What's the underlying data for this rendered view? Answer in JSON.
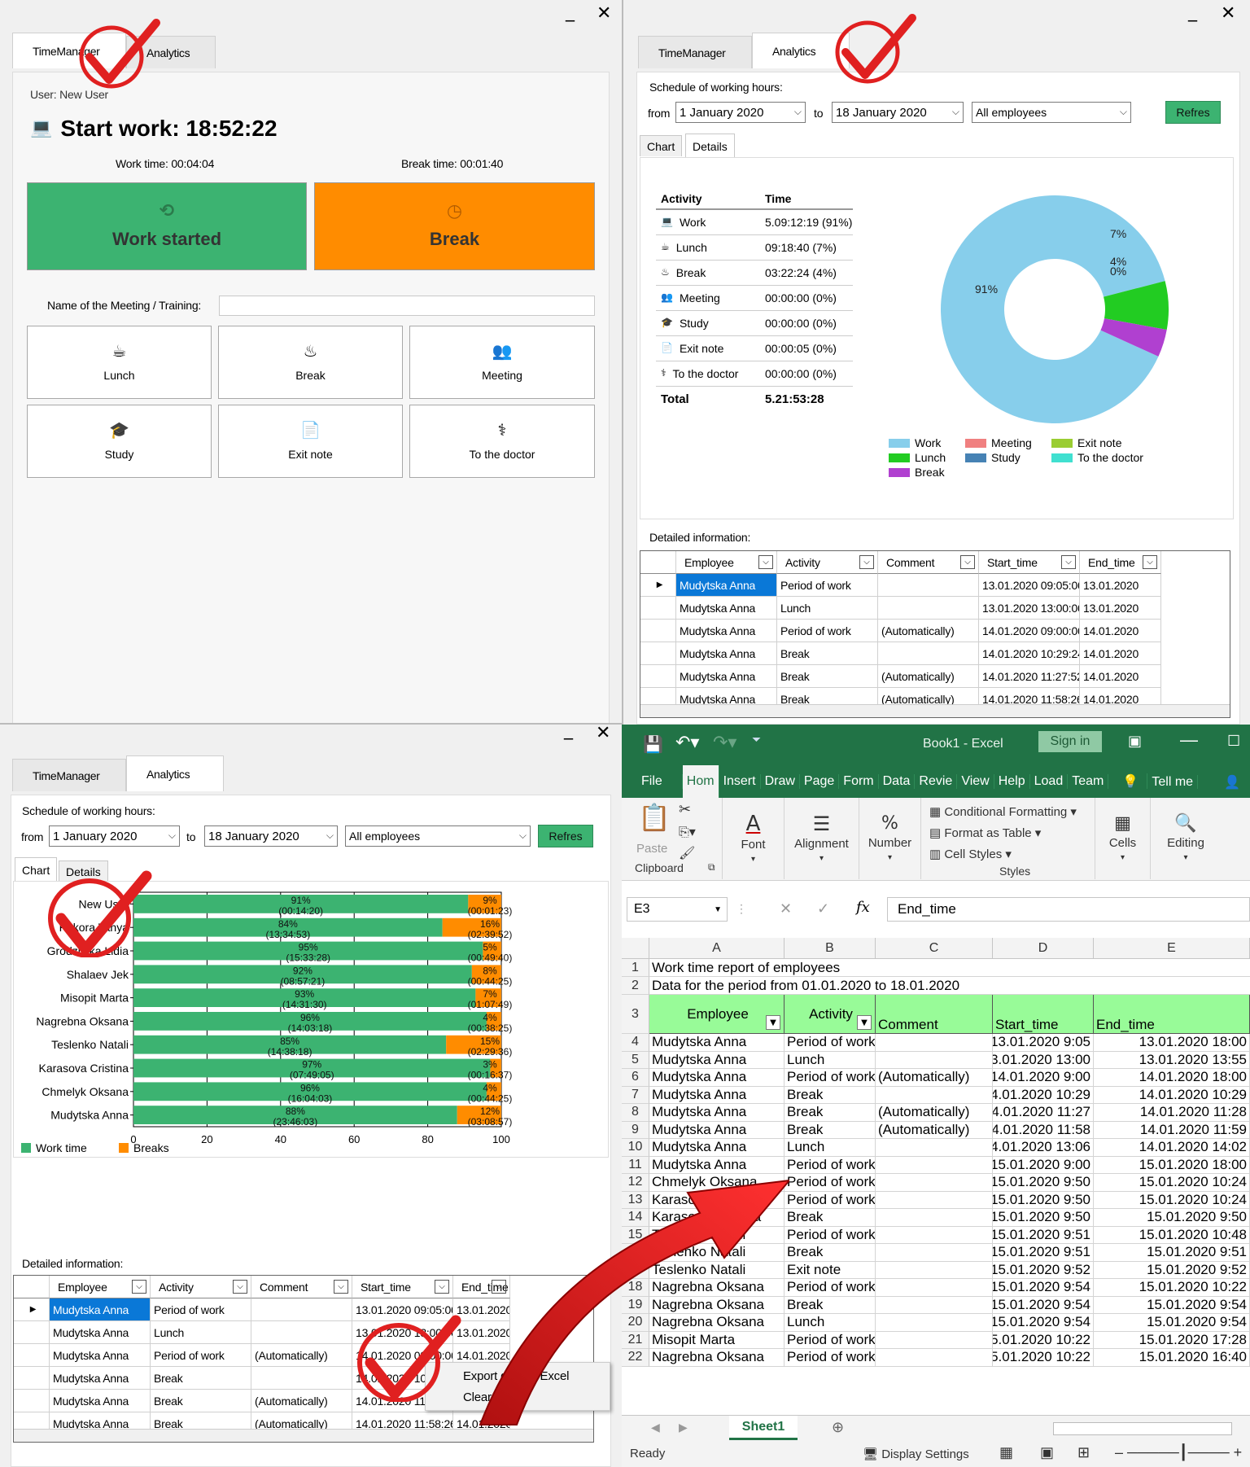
{
  "tm": {
    "tabs": [
      "TimeManager",
      "Analytics"
    ],
    "user": "User: New User",
    "start_work": "Start work: 18:52:22",
    "work_time": "Work time:  00:04:04",
    "break_time": "Break time:  00:01:40",
    "work_btn": "Work started",
    "break_btn": "Break",
    "meeting_label": "Name of the Meeting / Training:",
    "meeting_value": "",
    "actions": [
      "Lunch",
      "Break",
      "Meeting",
      "Study",
      "Exit note",
      "To the doctor"
    ]
  },
  "an": {
    "tabs": [
      "TimeManager",
      "Analytics"
    ],
    "schedule": "Schedule of working hours:",
    "from": "from",
    "from_val": "1 January 2020",
    "to": "to",
    "to_val": "18 January 2020",
    "emp": "All employees",
    "refresh": "Refres",
    "subtabs": [
      "Chart",
      "Details"
    ],
    "table_hdr": [
      "Activity",
      "Time"
    ],
    "rows": [
      {
        "icon": "laptop-icon",
        "glyph": "💻",
        "a": "Work",
        "t": "5.09:12:19 (91%)"
      },
      {
        "icon": "coffee-icon",
        "glyph": "☕",
        "a": "Lunch",
        "t": "09:18:40 (7%)"
      },
      {
        "icon": "relax-icon",
        "glyph": "♨",
        "a": "Break",
        "t": "03:22:24 (4%)"
      },
      {
        "icon": "people-icon",
        "glyph": "👥",
        "a": "Meeting",
        "t": "00:00:00 (0%)"
      },
      {
        "icon": "graduation-cap-icon",
        "glyph": "🎓",
        "a": "Study",
        "t": "00:00:00 (0%)"
      },
      {
        "icon": "document-icon",
        "glyph": "📄",
        "a": "Exit note",
        "t": "00:00:05 (0%)"
      },
      {
        "icon": "stethoscope-icon",
        "glyph": "⚕",
        "a": "To the doctor",
        "t": "00:00:00 (0%)"
      }
    ],
    "total_label": "Total",
    "total_val": "5.21:53:28",
    "detailed": "Detailed information:",
    "grid_hdr": [
      "Employee",
      "Activity",
      "Comment",
      "Start_time",
      "End_time"
    ],
    "grid_rows": [
      [
        "Mudytska Anna",
        "Period of work",
        "",
        "13.01.2020 09:05:00",
        "13.01.2020"
      ],
      [
        "Mudytska Anna",
        "Lunch",
        "",
        "13.01.2020 13:00:00",
        "13.01.2020"
      ],
      [
        "Mudytska Anna",
        "Period of work",
        "(Automatically)",
        "14.01.2020 09:00:00",
        "14.01.2020"
      ],
      [
        "Mudytska Anna",
        "Break",
        "",
        "14.01.2020 10:29:24",
        "14.01.2020"
      ],
      [
        "Mudytska Anna",
        "Break",
        "(Automatically)",
        "14.01.2020 11:27:52",
        "14.01.2020"
      ],
      [
        "Mudytska Anna",
        "Break",
        "(Automatically)",
        "14.01.2020 11:58:26",
        "14.01.2020"
      ]
    ]
  },
  "donut": {
    "type": "pie",
    "labels": [
      "Work",
      "Lunch",
      "Break",
      "Meeting",
      "Study",
      "Exit note",
      "To the doctor"
    ],
    "values": [
      91,
      7,
      4,
      0,
      0,
      0,
      0
    ],
    "slice_labels": [
      "91%",
      "7%",
      "4%",
      "0%"
    ],
    "colors": [
      "#87ceeb",
      "#22cc22",
      "#b040d0",
      "#f08080",
      "#4682b4",
      "#9acd32",
      "#40e0d0"
    ]
  },
  "chart_data": {
    "type": "bar",
    "orientation": "horizontal",
    "stacked": true,
    "categories": [
      "New User",
      "Pokora Tanya",
      "Grodzitska Lidia",
      "Shalaev Jek",
      "Misopit Marta",
      "Nagrebna Oksana",
      "Teslenko Natali",
      "Karasova Cristina",
      "Chmelyk Oksana",
      "Mudytska Anna"
    ],
    "series": [
      {
        "name": "Work time",
        "values": [
          91,
          84,
          95,
          92,
          93,
          96,
          85,
          97,
          96,
          88
        ],
        "labels": [
          "91%\n(00:14:20)",
          "84%\n(13:34:53)",
          "95%\n(15:33:28)",
          "92%\n(08:57:21)",
          "93%\n(14:31:30)",
          "96%\n(14:03:18)",
          "85%\n(14:38:18)",
          "97%\n(07:49:05)",
          "96%\n(16:04:03)",
          "88%\n(23:46:03)"
        ],
        "color": "#3cb371"
      },
      {
        "name": "Breaks",
        "values": [
          9,
          16,
          5,
          8,
          7,
          4,
          15,
          3,
          4,
          12
        ],
        "labels": [
          "9%\n(00:01:23)",
          "16%\n(02:39:52)",
          "5%\n(00:49:40)",
          "8%\n(00:44:25)",
          "7%\n(01:07:49)",
          "4%\n(00:38:25)",
          "15%\n(02:29:36)",
          "3%\n(00:16:37)",
          "4%\n(00:44:25)",
          "12%\n(03:08:57)"
        ],
        "color": "#ff8c00"
      }
    ],
    "xticks": [
      "0",
      "20",
      "40",
      "60",
      "80",
      "100"
    ],
    "xlim": [
      0,
      100
    ],
    "legend": "bottom-left"
  },
  "bl": {
    "context_menu": [
      "Export data to Excel",
      "Clear filters"
    ]
  },
  "xl": {
    "title": "Book1  -  Excel",
    "signin": "Sign in",
    "tabs": [
      "File",
      "Hom",
      "Insert",
      "Draw",
      "Page",
      "Form",
      "Data",
      "Revie",
      "View",
      "Help",
      "Load",
      "Team"
    ],
    "tellme": "Tell me",
    "ribbon": {
      "paste": "Paste",
      "clipboard": "Clipboard",
      "font": "Font",
      "alignment": "Alignment",
      "number": "Number",
      "cond": "Conditional Formatting",
      "table": "Format as Table",
      "cellstyles": "Cell Styles",
      "styles": "Styles",
      "cells": "Cells",
      "editing": "Editing"
    },
    "namebox": "E3",
    "formula": "End_time",
    "cols": [
      "A",
      "B",
      "C",
      "D",
      "E"
    ],
    "r1": "Work time report of employees",
    "r2": "Data for the period from 01.01.2020 to 18.01.2020",
    "hdr": [
      "Employee",
      "Activity",
      "Comment",
      "Start_time",
      "End_time"
    ],
    "rows": [
      [
        "Mudytska Anna",
        "Period of work",
        "",
        "13.01.2020 9:05",
        "13.01.2020 18:00"
      ],
      [
        "Mudytska Anna",
        "Lunch",
        "",
        "13.01.2020 13:00",
        "13.01.2020 13:55"
      ],
      [
        "Mudytska Anna",
        "Period of work",
        "(Automatically)",
        "14.01.2020 9:00",
        "14.01.2020 18:00"
      ],
      [
        "Mudytska Anna",
        "Break",
        "",
        "14.01.2020 10:29",
        "14.01.2020 10:29"
      ],
      [
        "Mudytska Anna",
        "Break",
        "(Automatically)",
        "14.01.2020 11:27",
        "14.01.2020 11:28"
      ],
      [
        "Mudytska Anna",
        "Break",
        "(Automatically)",
        "14.01.2020 11:58",
        "14.01.2020 11:59"
      ],
      [
        "Mudytska Anna",
        "Lunch",
        "",
        "14.01.2020 13:06",
        "14.01.2020 14:02"
      ],
      [
        "Mudytska Anna",
        "Period of work",
        "",
        "15.01.2020 9:00",
        "15.01.2020 18:00"
      ],
      [
        "Chmelyk Oksana",
        "Period of work",
        "",
        "15.01.2020 9:50",
        "15.01.2020 10:24"
      ],
      [
        "Karasova Cristina",
        "Period of work",
        "",
        "15.01.2020 9:50",
        "15.01.2020 10:24"
      ],
      [
        "Karasova Cristina",
        "Break",
        "",
        "15.01.2020 9:50",
        "15.01.2020 9:50"
      ],
      [
        "Teslenko Natali",
        "Period of work",
        "",
        "15.01.2020 9:51",
        "15.01.2020 10:48"
      ],
      [
        "Teslenko Natali",
        "Break",
        "",
        "15.01.2020 9:51",
        "15.01.2020 9:51"
      ],
      [
        "Teslenko Natali",
        "Exit note",
        "",
        "15.01.2020 9:52",
        "15.01.2020 9:52"
      ],
      [
        "Nagrebna Oksana",
        "Period of work",
        "",
        "15.01.2020 9:54",
        "15.01.2020 10:22"
      ],
      [
        "Nagrebna Oksana",
        "Break",
        "",
        "15.01.2020 9:54",
        "15.01.2020 9:54"
      ],
      [
        "Nagrebna Oksana",
        "Lunch",
        "",
        "15.01.2020 9:54",
        "15.01.2020 9:54"
      ],
      [
        "Misopit Marta",
        "Period of work",
        "",
        "15.01.2020 10:22",
        "15.01.2020 17:28"
      ],
      [
        "Nagrebna Oksana",
        "Period of work",
        "",
        "15.01.2020 10:22",
        "15.01.2020 16:40"
      ]
    ],
    "sheet": "Sheet1",
    "ready": "Ready",
    "display": "Display Settings"
  }
}
